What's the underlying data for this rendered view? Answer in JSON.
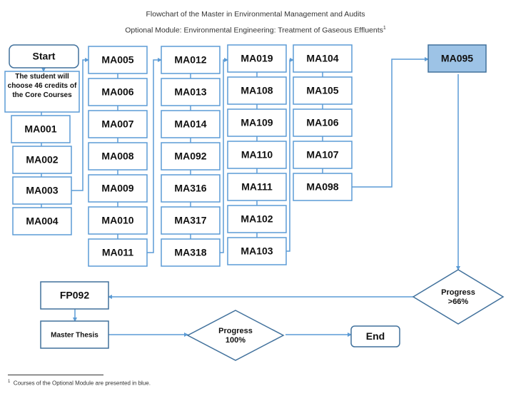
{
  "header": {
    "title": "Flowchart of the Master in Environmental Management and Audits",
    "subtitle": "Optional Module: Environmental Engineering: Treatment of Gaseous Effluents",
    "subtitle_footnote_mark": "1"
  },
  "colors": {
    "line": "#5b9bd5",
    "optional_fill": "#9dc3e6",
    "optional_stroke": "#41719c"
  },
  "flow": {
    "start": "Start",
    "intro": [
      "The student will",
      "choose 46 credits of",
      "the Core Courses"
    ],
    "columns": [
      [
        "MA001",
        "MA002",
        "MA003",
        "MA004"
      ],
      [
        "MA005",
        "MA006",
        "MA007",
        "MA008",
        "MA009",
        "MA010",
        "MA011"
      ],
      [
        "MA012",
        "MA013",
        "MA014",
        "MA092",
        "MA316",
        "MA317",
        "MA318"
      ],
      [
        "MA019",
        "MA108",
        "MA109",
        "MA110",
        "MA111",
        "MA102",
        "MA103"
      ],
      [
        "MA104",
        "MA105",
        "MA106",
        "MA107",
        "MA098"
      ]
    ],
    "optional_course": "MA095",
    "decision_1": [
      "Progress",
      ">66%"
    ],
    "fp": "FP092",
    "thesis": "Master Thesis",
    "decision_2": [
      "Progress",
      "100%"
    ],
    "end": "End"
  },
  "footnote": {
    "mark": "1",
    "text": "Courses of the Optional Module are presented in blue."
  }
}
